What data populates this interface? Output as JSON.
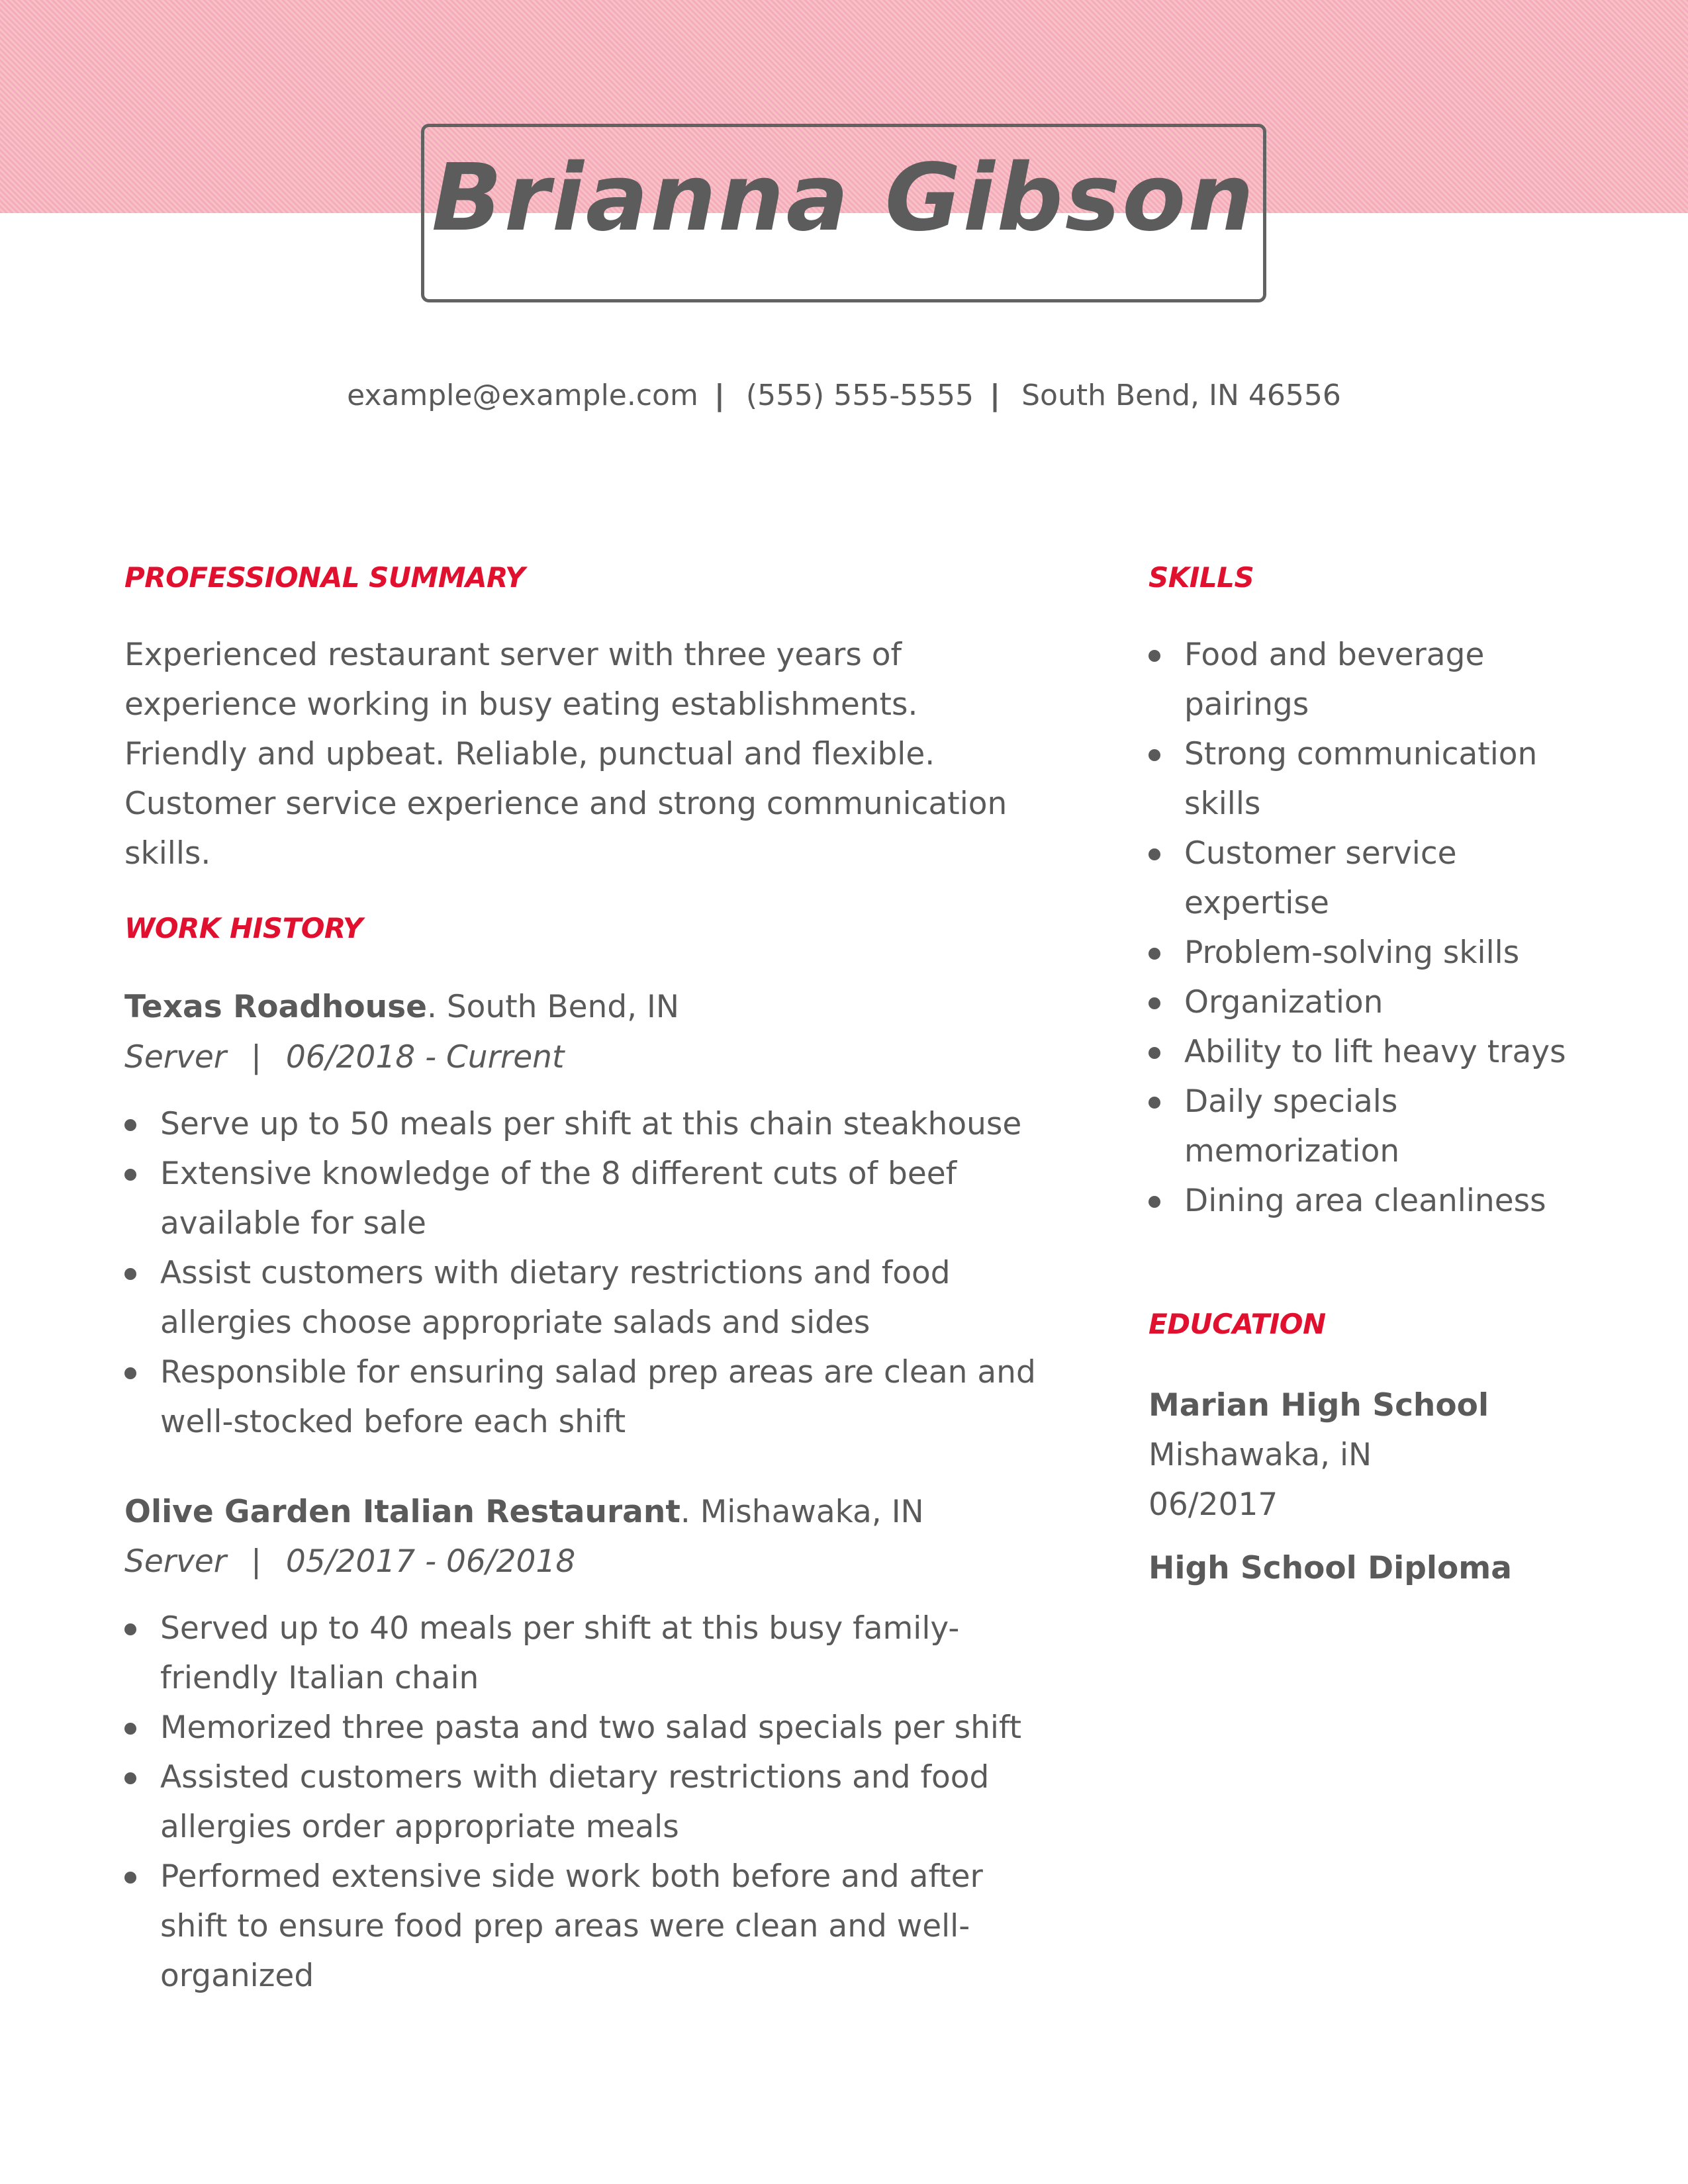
{
  "header": {
    "name": "Brianna Gibson",
    "email": "example@example.com",
    "phone": "(555) 555-5555",
    "location": "South Bend, IN 46556",
    "separator": "|"
  },
  "colors": {
    "accent": "#e0102e",
    "text": "#5a5a5a",
    "band": "#f7bcc6"
  },
  "summary": {
    "heading": "PROFESSIONAL SUMMARY",
    "text": "Experienced restaurant server with three years of experience working in busy eating establishments. Friendly and upbeat. Reliable, punctual and flexible. Customer service experience and strong communication skills."
  },
  "work": {
    "heading": "WORK HISTORY",
    "jobs": [
      {
        "company": "Texas Roadhouse",
        "location": ". South Bend, IN",
        "title": "Server",
        "sep": "|",
        "dates": "06/2018 - Current",
        "bullets": [
          "Serve up to 50 meals per shift at this chain steakhouse",
          "Extensive knowledge of the 8 different cuts of beef available for sale",
          "Assist customers with dietary restrictions and food allergies choose appropriate salads and sides",
          "Responsible for ensuring salad prep areas are clean and well-stocked before each shift"
        ]
      },
      {
        "company": "Olive Garden Italian Restaurant",
        "location": ". Mishawaka, IN",
        "title": "Server",
        "sep": "|",
        "dates": "05/2017 - 06/2018",
        "bullets": [
          "Served up to 40 meals per shift at this busy family-friendly Italian chain",
          "Memorized three pasta and two salad specials per shift",
          "Assisted customers with dietary restrictions and food allergies order appropriate meals",
          "Performed extensive side work both before and after shift to ensure food prep areas were clean and well-organized"
        ]
      }
    ]
  },
  "skills": {
    "heading": "SKILLS",
    "items": [
      "Food and beverage pairings",
      "Strong communication skills",
      "Customer service expertise",
      "Problem-solving skills",
      "Organization",
      "Ability to lift heavy trays",
      "Daily specials memorization",
      "Dining area cleanliness"
    ]
  },
  "education": {
    "heading": "EDUCATION",
    "school": "Marian High School",
    "location": "Mishawaka, iN",
    "date": "06/2017",
    "degree": "High School Diploma"
  }
}
